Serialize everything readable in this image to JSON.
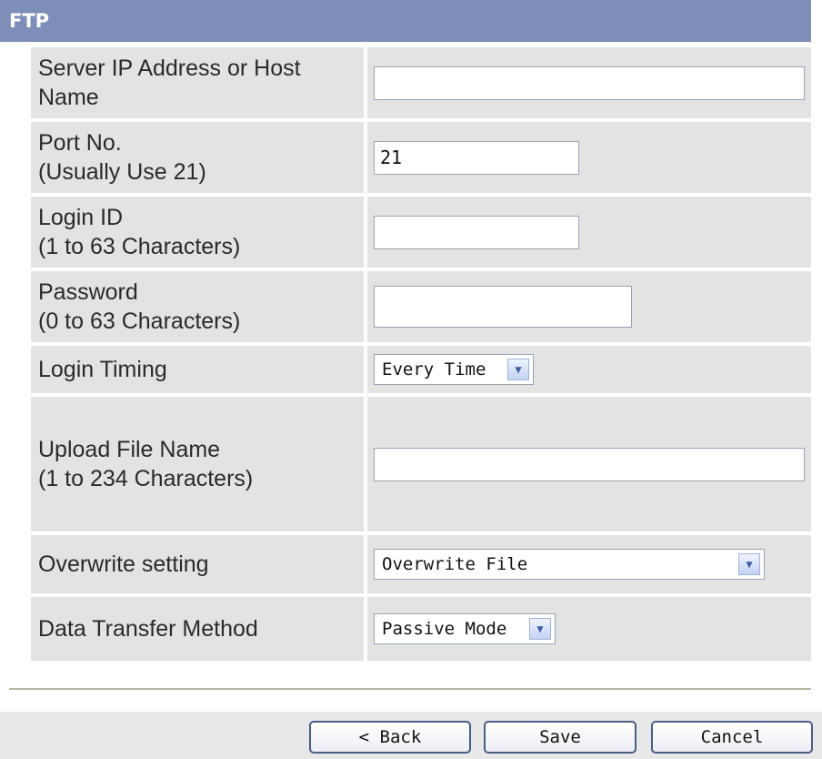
{
  "header": {
    "title": "FTP"
  },
  "form": {
    "server": {
      "label_line1": "Server IP Address or Host",
      "label_line2": "Name",
      "value": ""
    },
    "port": {
      "label_line1": "Port No.",
      "label_line2": "(Usually Use 21)",
      "value": "21"
    },
    "login_id": {
      "label_line1": "Login ID",
      "label_line2": "(1 to 63 Characters)",
      "value": ""
    },
    "password": {
      "label_line1": "Password",
      "label_line2": "(0 to 63 Characters)",
      "value": ""
    },
    "login_timing": {
      "label": "Login Timing",
      "selected": "Every Time"
    },
    "upload_file": {
      "label_line1": "Upload File Name",
      "label_line2": "(1 to 234 Characters)",
      "value": ""
    },
    "overwrite": {
      "label": "Overwrite setting",
      "selected": "Overwrite File"
    },
    "transfer": {
      "label": "Data Transfer Method",
      "selected": "Passive Mode"
    }
  },
  "footer": {
    "back_label": "< Back",
    "save_label": "Save",
    "cancel_label": "Cancel"
  },
  "colors": {
    "header": "#7d8fb8",
    "cell": "#e3e3e3",
    "footer": "#e8e8e8"
  }
}
